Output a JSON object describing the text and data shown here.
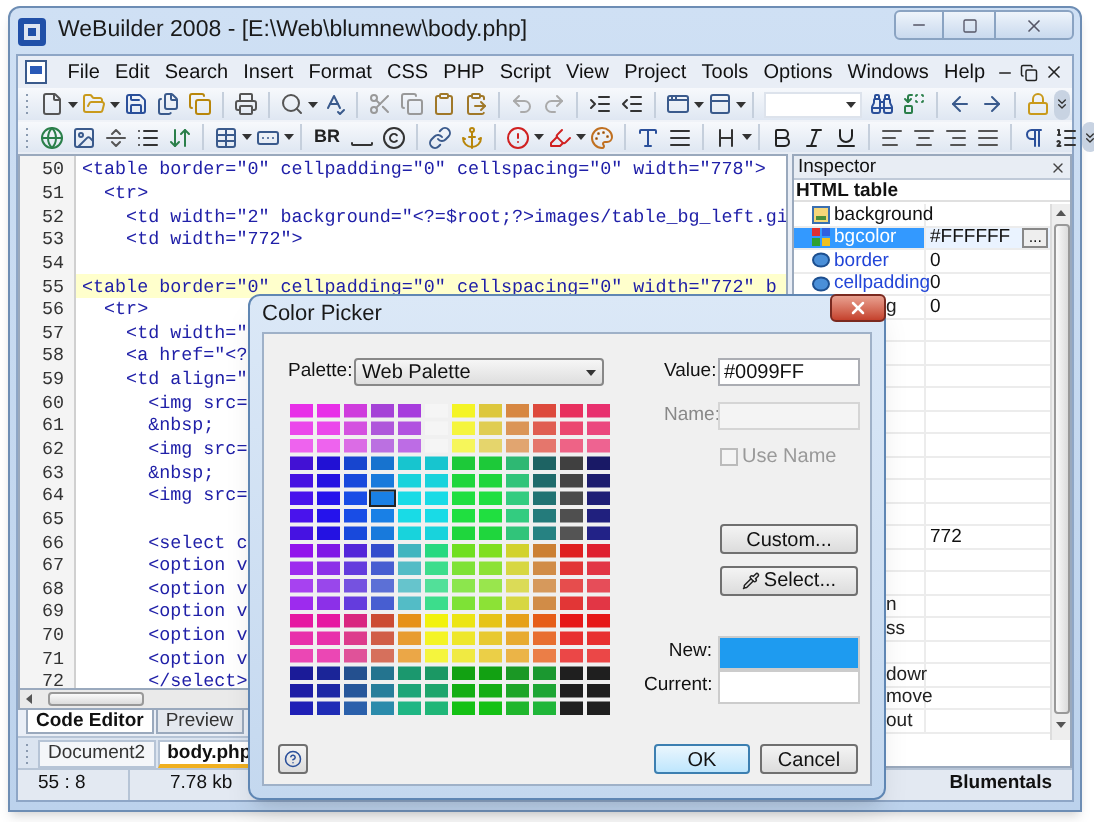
{
  "window": {
    "title": "WeBuilder 2008 - [E:\\Web\\blumnew\\body.php]"
  },
  "menu": [
    "File",
    "Edit",
    "Search",
    "Insert",
    "Format",
    "CSS",
    "PHP",
    "Script",
    "View",
    "Project",
    "Tools",
    "Options",
    "Windows",
    "Help"
  ],
  "toolbar": {
    "br_label": "BR"
  },
  "editor": {
    "lines": [
      {
        "number": "50",
        "text": "<table border=\"0\" cellpadding=\"0\" cellspacing=\"0\" width=\"778\">",
        "highlighted": false
      },
      {
        "number": "51",
        "text": "  <tr>",
        "highlighted": false
      },
      {
        "number": "52",
        "text": "    <td width=\"2\" background=\"<?=$root;?>images/table_bg_left.gi",
        "highlighted": false
      },
      {
        "number": "53",
        "text": "    <td width=\"772\">",
        "highlighted": false
      },
      {
        "number": "54",
        "highlighted": false
      },
      {
        "number": "55",
        "text": "<table border=\"0\" cellpadding=\"0\" cellspacing=\"0\" width=\"772\" b",
        "highlighted": true
      },
      {
        "number": "56",
        "text": "  <tr>",
        "highlighted": false
      },
      {
        "number": "57",
        "text": "    <td width=\"",
        "highlighted": false
      },
      {
        "number": "58",
        "text": "    <a href=\"<?",
        "highlighted": false
      },
      {
        "number": "59",
        "text": "    <td align=\"",
        "highlighted": false
      },
      {
        "number": "60",
        "text": "      <img src=",
        "highlighted": false
      },
      {
        "number": "61",
        "text": "      &nbsp;",
        "highlighted": false
      },
      {
        "number": "62",
        "text": "      <img src=",
        "highlighted": false
      },
      {
        "number": "63",
        "text": "      &nbsp;",
        "highlighted": false
      },
      {
        "number": "64",
        "text": "      <img src=",
        "highlighted": false
      },
      {
        "number": "65",
        "highlighted": false
      },
      {
        "number": "66",
        "text": "      <select c",
        "highlighted": false
      },
      {
        "number": "67",
        "text": "      <option v",
        "highlighted": false
      },
      {
        "number": "68",
        "text": "      <option v",
        "highlighted": false
      },
      {
        "number": "69",
        "text": "      <option v",
        "highlighted": false
      },
      {
        "number": "70",
        "text": "      <option v",
        "highlighted": false
      },
      {
        "number": "71",
        "text": "      <option v",
        "highlighted": false
      },
      {
        "number": "72",
        "text": "      </select>",
        "highlighted": false
      }
    ]
  },
  "editor_tabs": [
    {
      "label": "Code Editor",
      "selected": true
    },
    {
      "label": "Preview",
      "selected": false
    }
  ],
  "document_tabs": [
    {
      "label": "Document2",
      "selected": false
    },
    {
      "label": "body.php",
      "selected": true
    }
  ],
  "inspector": {
    "title": "Inspector",
    "element": "HTML table",
    "properties": [
      {
        "kind": "image",
        "name": "background",
        "selected": false
      },
      {
        "kind": "color",
        "name": "bgcolor",
        "value": "#FFFFFF",
        "button": "...",
        "selected": true
      },
      {
        "kind": "attr",
        "name": "border",
        "value": "0",
        "selected": false
      },
      {
        "kind": "attr",
        "name": "cellpadding",
        "value": "0",
        "selected": false
      },
      {
        "kind": "cut",
        "name": "g",
        "value": "0",
        "selected": false
      },
      {
        "kind": "blank",
        "selected": false
      },
      {
        "kind": "blank",
        "selected": false
      },
      {
        "kind": "blank",
        "selected": false
      },
      {
        "kind": "blank",
        "selected": false
      },
      {
        "kind": "blank",
        "selected": false
      },
      {
        "kind": "blank",
        "selected": false
      },
      {
        "kind": "blank",
        "selected": false
      },
      {
        "kind": "blank",
        "selected": false
      },
      {
        "kind": "blank",
        "selected": false
      },
      {
        "kind": "cut",
        "value": "772",
        "selected": false
      },
      {
        "kind": "blank",
        "selected": false
      },
      {
        "kind": "blank",
        "selected": false
      },
      {
        "kind": "cut",
        "name": "n",
        "selected": false
      },
      {
        "kind": "cut",
        "name": "ss",
        "selected": false
      },
      {
        "kind": "blank",
        "selected": false
      },
      {
        "kind": "cut",
        "name": "dowr",
        "selected": false
      },
      {
        "kind": "cut",
        "name": "move",
        "selected": false
      },
      {
        "kind": "cut",
        "name": "out",
        "selected": false
      }
    ]
  },
  "status_bar": {
    "position": "55 : 8",
    "size": "7.78 kb",
    "brand": "Blumentals"
  },
  "dialog": {
    "title": "Color Picker",
    "palette_label": "Palette:",
    "palette": "Web Palette",
    "value_label": "Value:",
    "value": "#0099FF",
    "name_label": "Name:",
    "use_name": {
      "label": "Use Name",
      "checked": false,
      "disabled": true
    },
    "custom_button": "Custom...",
    "select_button": "Select...",
    "swatches": [
      {
        "label": "New:",
        "color": "#1e9bf0"
      },
      {
        "label": "Current:",
        "color": "#ffffff"
      }
    ],
    "ok": "OK",
    "cancel": "Cancel"
  }
}
